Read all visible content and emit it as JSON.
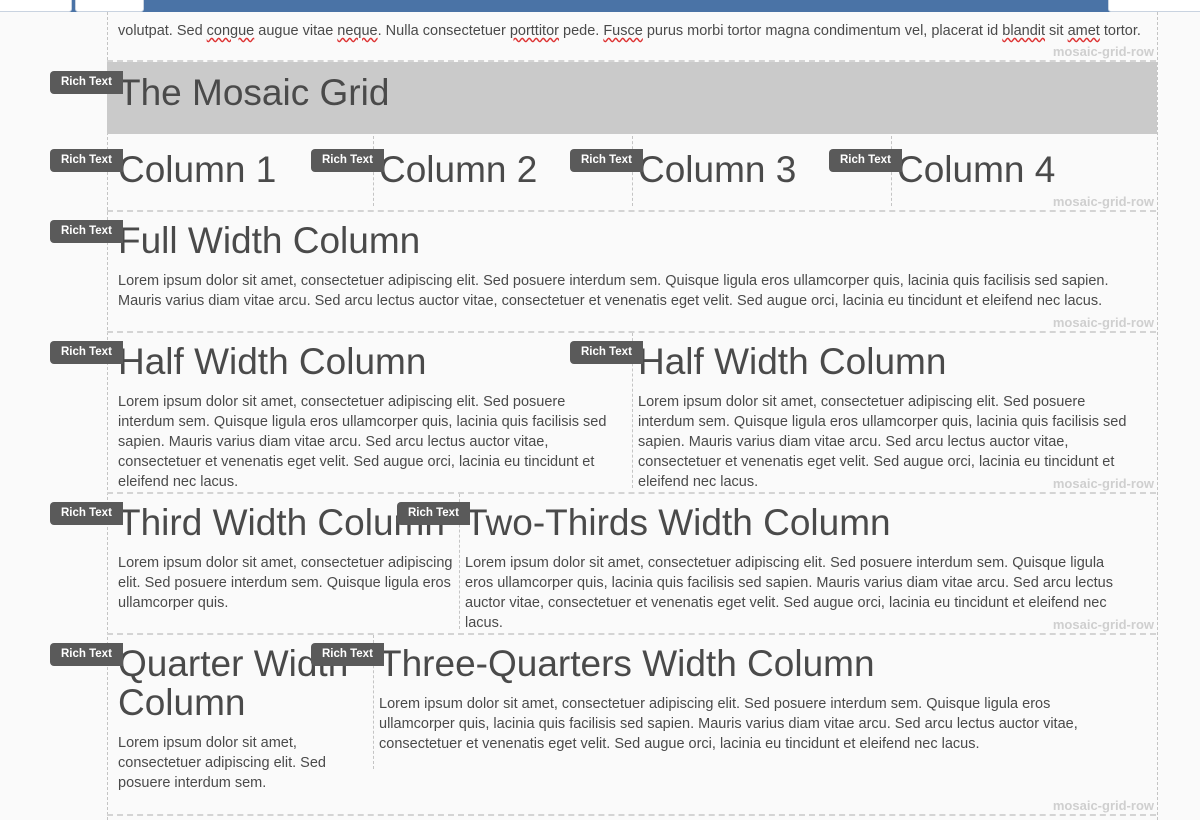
{
  "badge_label": "Rich Text",
  "row_label": "mosaic-grid-row",
  "top_text": {
    "before": "volutpat. Sed ",
    "w1": "congue",
    "mid1": " augue vitae ",
    "w2": "neque",
    "mid2": ". Nulla consectetuer ",
    "w3": "porttitor",
    "mid3": " pede. ",
    "w4": "Fusce",
    "mid4": " purus morbi tortor magna condimentum vel, placerat id ",
    "w5": "blandit",
    "mid5": " sit ",
    "w6": "amet",
    "after": " tortor."
  },
  "main_title": "The Mosaic Grid",
  "columns_row": [
    "Column 1",
    "Column 2",
    "Column 3",
    "Column 4"
  ],
  "full_width": {
    "heading": "Full Width Column",
    "body": "Lorem ipsum dolor sit amet, consectetuer adipiscing elit. Sed posuere interdum sem. Quisque ligula eros ullamcorper quis, lacinia quis facilisis sed sapien. Mauris varius diam vitae arcu. Sed arcu lectus auctor vitae, consectetuer et venenatis eget velit. Sed augue orci, lacinia eu tincidunt et eleifend nec lacus."
  },
  "half_width": [
    {
      "heading": "Half Width Column",
      "body": "Lorem ipsum dolor sit amet, consectetuer adipiscing elit. Sed posuere interdum sem. Quisque ligula eros ullamcorper quis, lacinia quis facilisis sed sapien. Mauris varius diam vitae arcu. Sed arcu lectus auctor vitae, consectetuer et venenatis eget velit. Sed augue orci, lacinia eu tincidunt et eleifend nec lacus."
    },
    {
      "heading": "Half Width Column",
      "body": "Lorem ipsum dolor sit amet, consectetuer adipiscing elit. Sed posuere interdum sem. Quisque ligula eros ullamcorper quis, lacinia quis facilisis sed sapien. Mauris varius diam vitae arcu. Sed arcu lectus auctor vitae, consectetuer et venenatis eget velit. Sed augue orci, lacinia eu tincidunt et eleifend nec lacus."
    }
  ],
  "third_row": {
    "third": {
      "heading": "Third Width Column",
      "body": "Lorem ipsum dolor sit amet, consectetuer adipiscing elit. Sed posuere interdum sem. Quisque ligula eros ullamcorper quis."
    },
    "two_thirds": {
      "heading": "Two-Thirds Width Column",
      "body": "Lorem ipsum dolor sit amet, consectetuer adipiscing elit. Sed posuere interdum sem. Quisque ligula eros ullamcorper quis, lacinia quis facilisis sed sapien. Mauris varius diam vitae arcu. Sed arcu lectus auctor vitae, consectetuer et venenatis eget velit. Sed augue orci, lacinia eu tincidunt et eleifend nec lacus."
    }
  },
  "quarter_row": {
    "quarter": {
      "heading": "Quarter Width Column",
      "body": "Lorem ipsum dolor sit amet, consectetuer adipiscing elit. Sed posuere interdum sem."
    },
    "three_quarters": {
      "heading": "Three-Quarters Width Column",
      "body": "Lorem ipsum dolor sit amet, consectetuer adipiscing elit. Sed posuere interdum sem. Quisque ligula eros ullamcorper quis, lacinia quis facilisis sed sapien. Mauris varius diam vitae arcu. Sed arcu lectus auctor vitae, consectetuer et venenatis eget velit. Sed augue orci, lacinia eu tincidunt et eleifend nec lacus."
    }
  }
}
